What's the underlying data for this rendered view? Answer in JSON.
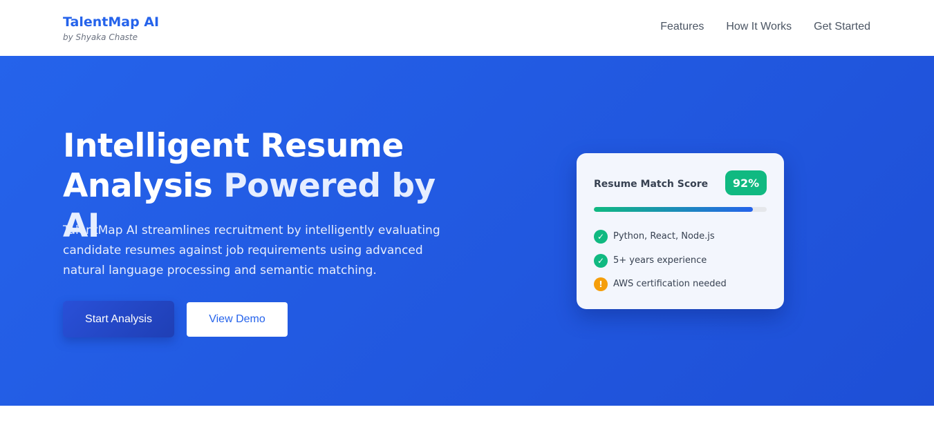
{
  "header": {
    "brand_name": "TalentMap AI",
    "brand_sub": "by Shyaka Chaste",
    "nav": [
      "Features",
      "How It Works",
      "Get Started"
    ]
  },
  "hero": {
    "title_line1": "Intelligent Resume",
    "title_line2a": "Analysis ",
    "title_line2b": "Powered by AI",
    "description": "TalentMap AI streamlines recruitment by intelligently evaluating candidate resumes against job requirements using advanced natural language processing and semantic matching.",
    "primary_button": "Start Analysis",
    "secondary_button": "View Demo"
  },
  "card": {
    "title": "Resume Match Score",
    "score": "92%",
    "score_fraction": 0.92,
    "items": [
      {
        "text": "Python, React, Node.js",
        "status": "ok",
        "icon": "check-circle-icon"
      },
      {
        "text": "5+ years experience",
        "status": "ok",
        "icon": "check-circle-icon"
      },
      {
        "text": "AWS certification needed",
        "status": "warn",
        "icon": "warning-circle-icon"
      }
    ]
  },
  "colors": {
    "accent": "#2563eb",
    "success": "#10b981",
    "warning": "#f59e0b"
  }
}
